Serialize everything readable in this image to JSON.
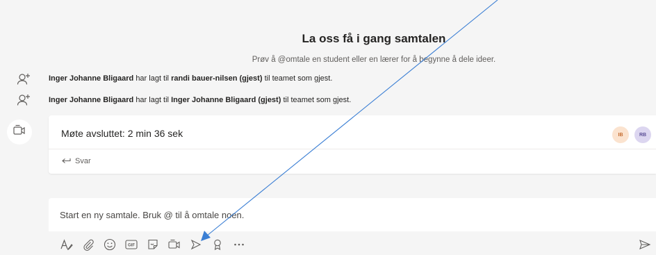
{
  "conversation": {
    "title": "La oss få i gang samtalen",
    "subtitle": "Prøv å @omtale en student eller en lærer for å begynne å dele ideer."
  },
  "system_messages": [
    {
      "actor": "Inger Johanne Bligaard",
      "verb": "har lagt til",
      "target": "randi bauer-nilsen (gjest)",
      "suffix": "til teamet som gjest.",
      "icon": "add-person-icon"
    },
    {
      "actor": "Inger Johanne Bligaard",
      "verb": "har lagt til",
      "target": "Inger Johanne Bligaard (gjest)",
      "suffix": "til teamet som gjest.",
      "icon": "add-person-icon"
    }
  ],
  "meeting": {
    "icon": "video-camera-icon",
    "title": "Møte avsluttet: 2 min 36 sek",
    "reply_label": "Svar",
    "participants": [
      {
        "initials": "IB",
        "bg": "#fbe3cf",
        "fg": "#c36a2d"
      },
      {
        "initials": "RB",
        "bg": "#dcd6f0",
        "fg": "#5b4f96"
      }
    ]
  },
  "composer": {
    "placeholder": "Start en ny samtale. Bruk @ til å omtale noen.",
    "toolbar": [
      "format-icon",
      "attach-icon",
      "emoji-icon",
      "gif-icon",
      "sticker-icon",
      "meet-now-icon",
      "stream-icon",
      "praise-icon",
      "more-icon"
    ],
    "gif_label": "GIF",
    "send_icon": "send-icon"
  },
  "colors": {
    "background": "#f5f5f5",
    "card": "#ffffff",
    "annotation_arrow": "#3b7fd4"
  }
}
